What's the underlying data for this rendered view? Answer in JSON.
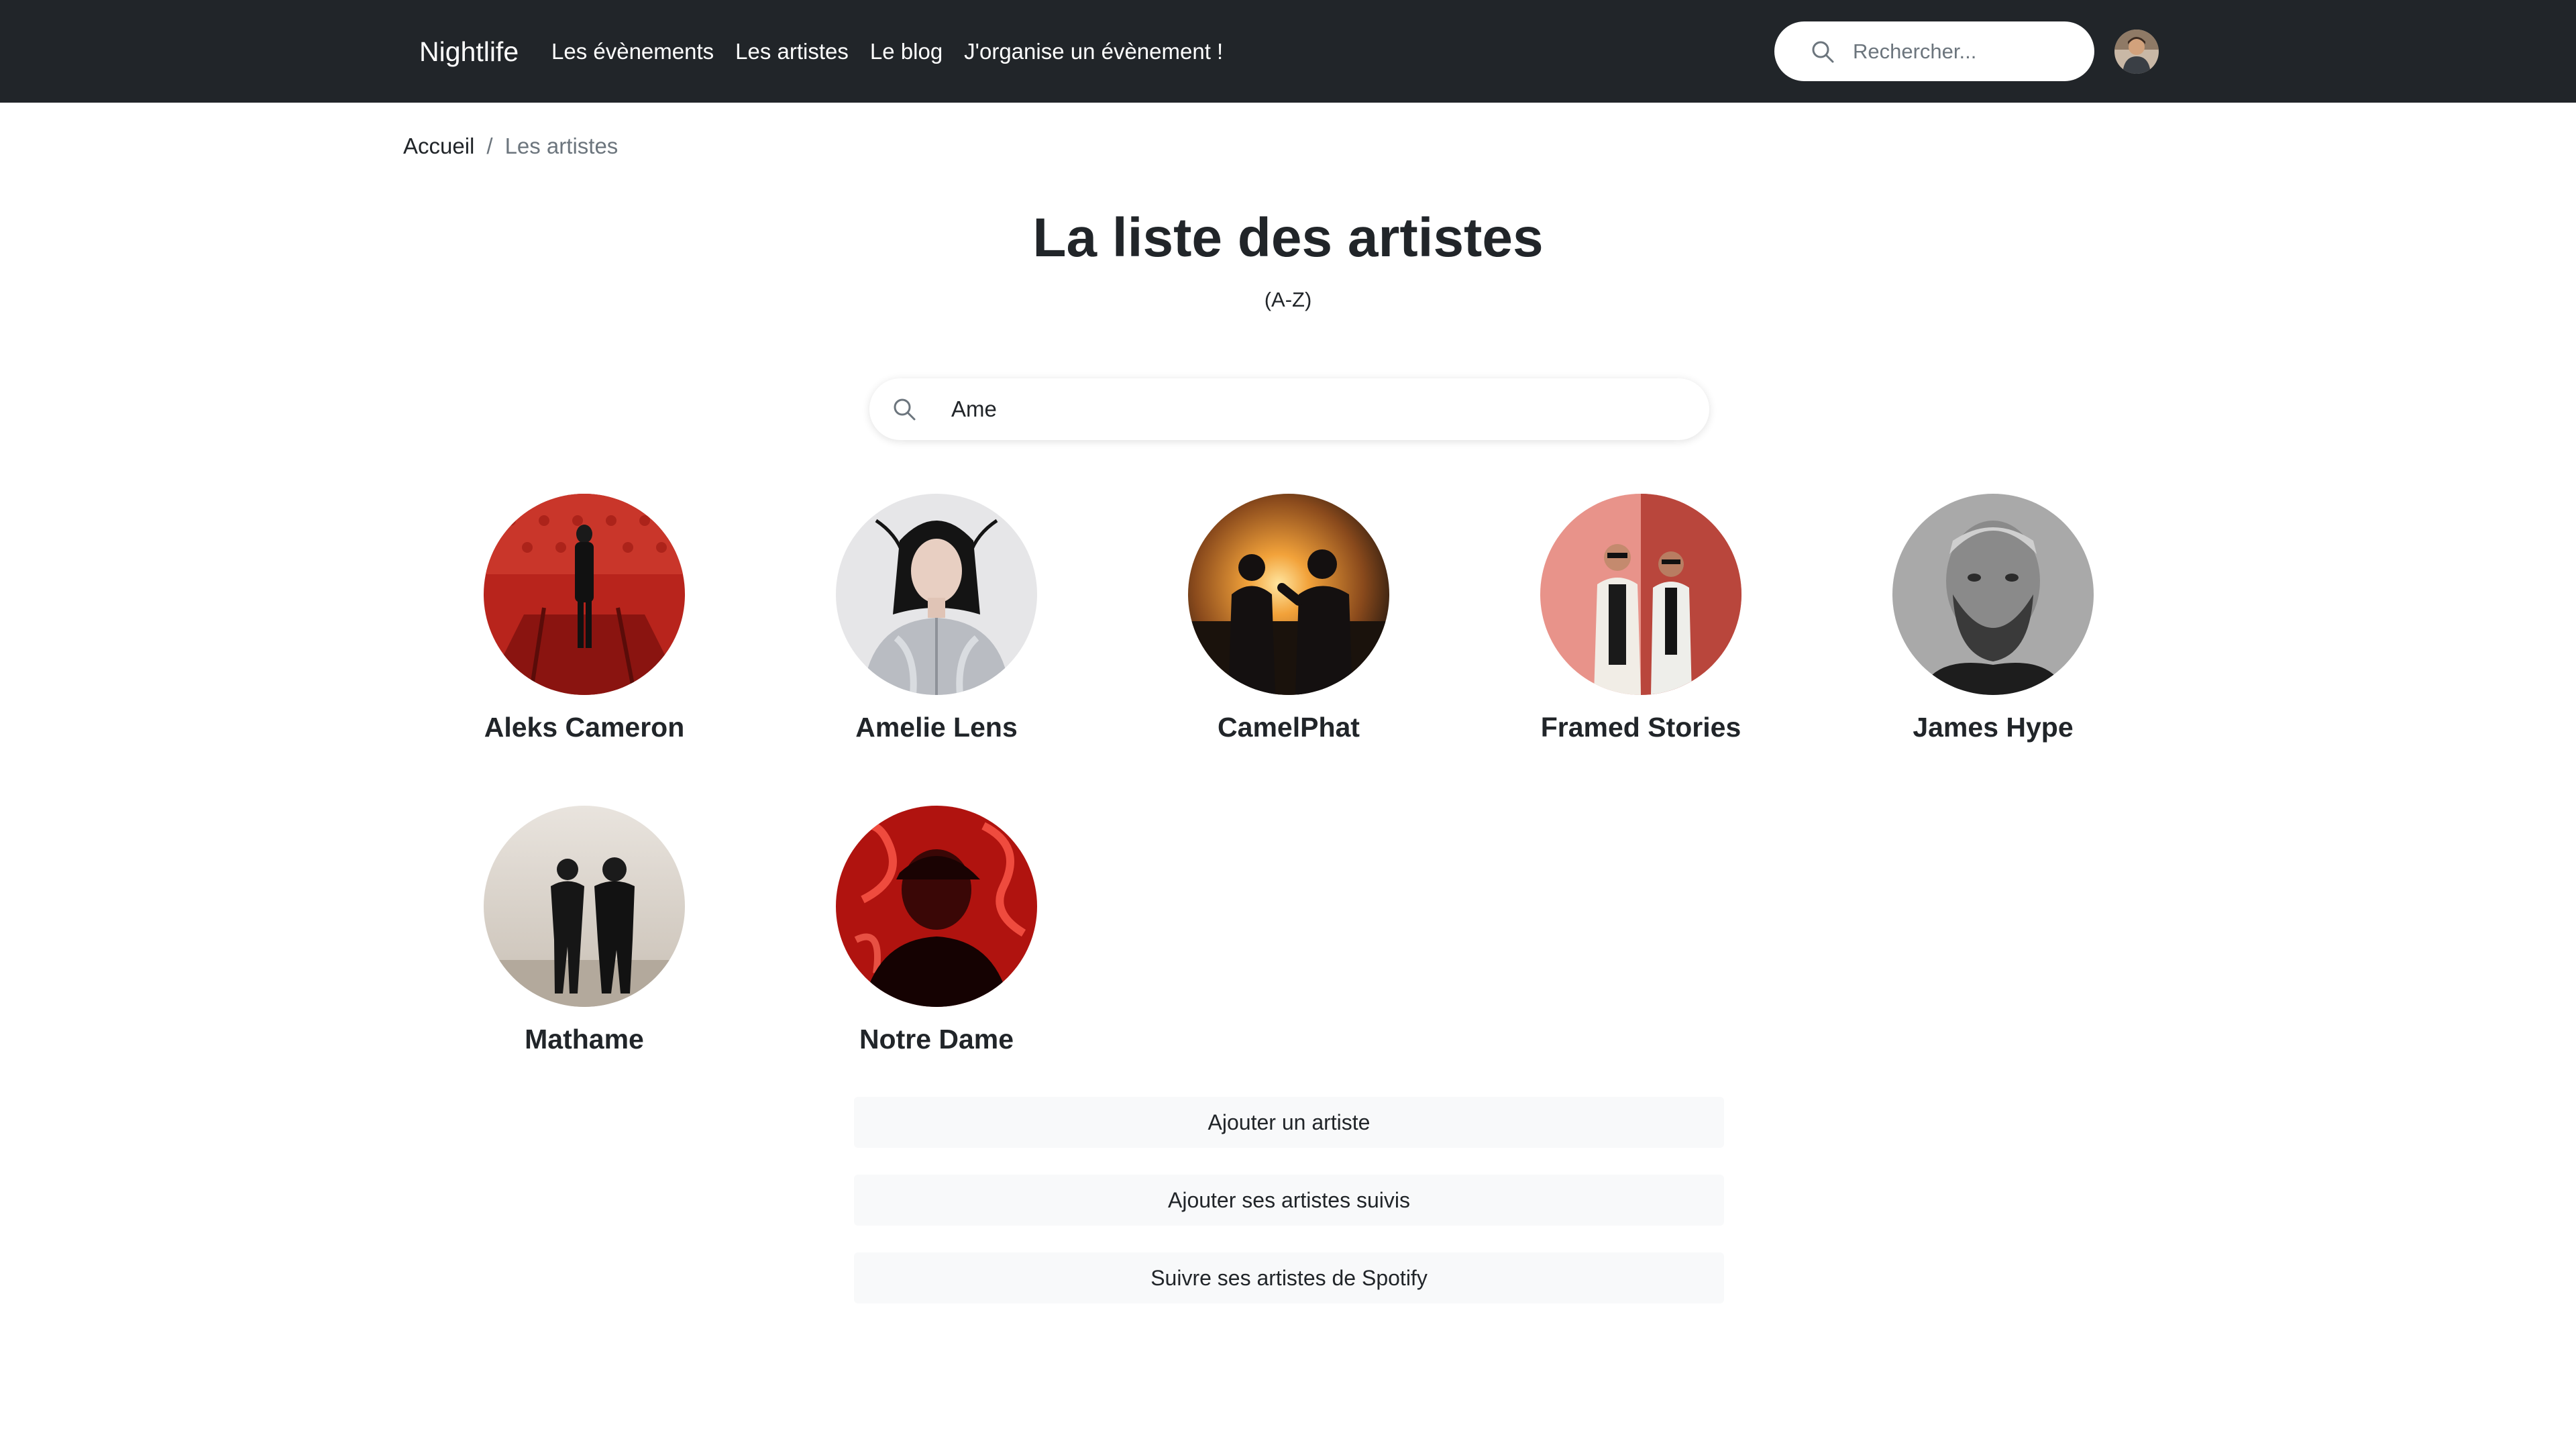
{
  "navbar": {
    "brand": "Nightlife",
    "links": [
      "Les évènements",
      "Les artistes",
      "Le blog",
      "J'organise un évènement !"
    ],
    "search_placeholder": "Rechercher..."
  },
  "breadcrumb": {
    "home": "Accueil",
    "separator": "/",
    "current": "Les artistes"
  },
  "page": {
    "title": "La liste des artistes",
    "subtitle": "(A-Z)"
  },
  "artist_search": {
    "value": "Ame"
  },
  "artists": [
    "Aleks Cameron",
    "Amelie Lens",
    "CamelPhat",
    "Framed Stories",
    "James Hype",
    "Mathame",
    "Notre Dame"
  ],
  "actions": {
    "add_artist": "Ajouter un artiste",
    "add_followed": "Ajouter ses artistes suivis",
    "follow_spotify": "Suivre ses artistes de Spotify"
  },
  "colors": {
    "navbar_bg": "#212529",
    "button_bg": "#f8f9fa",
    "text": "#212529",
    "muted": "#6c757d"
  }
}
